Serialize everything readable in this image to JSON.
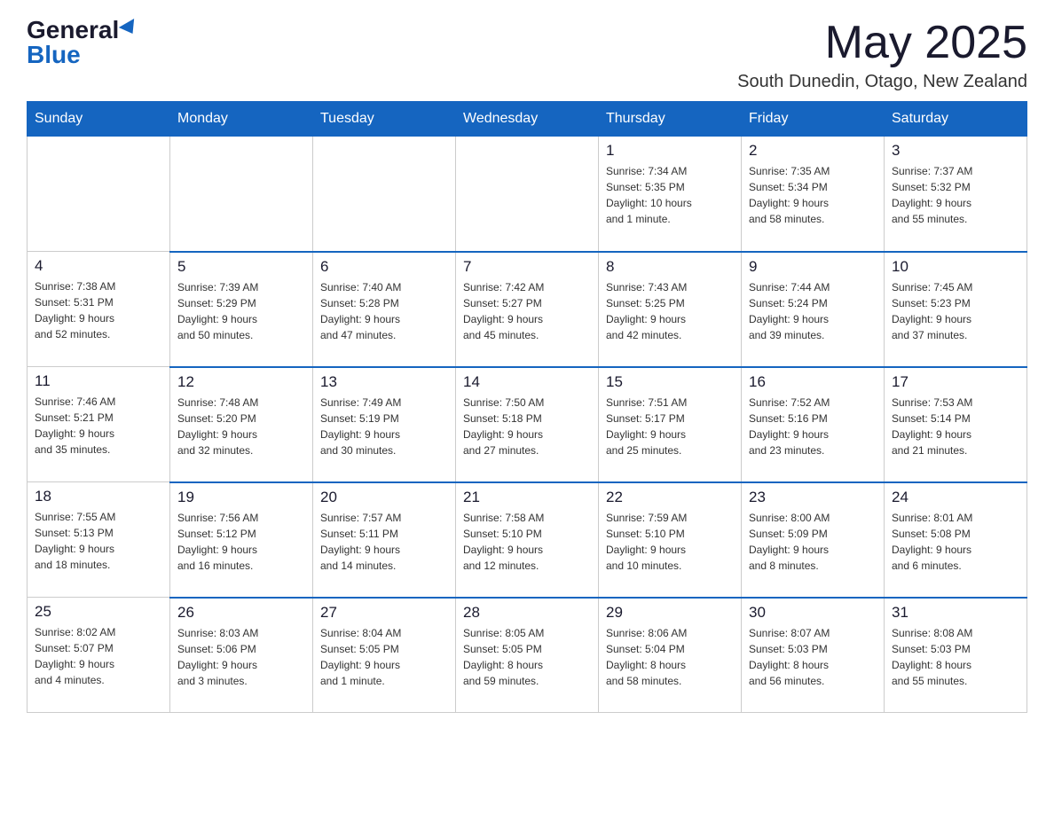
{
  "header": {
    "logo_general": "General",
    "logo_blue": "Blue",
    "month_title": "May 2025",
    "location": "South Dunedin, Otago, New Zealand"
  },
  "weekdays": [
    "Sunday",
    "Monday",
    "Tuesday",
    "Wednesday",
    "Thursday",
    "Friday",
    "Saturday"
  ],
  "weeks": [
    [
      {
        "day": "",
        "info": ""
      },
      {
        "day": "",
        "info": ""
      },
      {
        "day": "",
        "info": ""
      },
      {
        "day": "",
        "info": ""
      },
      {
        "day": "1",
        "info": "Sunrise: 7:34 AM\nSunset: 5:35 PM\nDaylight: 10 hours\nand 1 minute."
      },
      {
        "day": "2",
        "info": "Sunrise: 7:35 AM\nSunset: 5:34 PM\nDaylight: 9 hours\nand 58 minutes."
      },
      {
        "day": "3",
        "info": "Sunrise: 7:37 AM\nSunset: 5:32 PM\nDaylight: 9 hours\nand 55 minutes."
      }
    ],
    [
      {
        "day": "4",
        "info": "Sunrise: 7:38 AM\nSunset: 5:31 PM\nDaylight: 9 hours\nand 52 minutes."
      },
      {
        "day": "5",
        "info": "Sunrise: 7:39 AM\nSunset: 5:29 PM\nDaylight: 9 hours\nand 50 minutes."
      },
      {
        "day": "6",
        "info": "Sunrise: 7:40 AM\nSunset: 5:28 PM\nDaylight: 9 hours\nand 47 minutes."
      },
      {
        "day": "7",
        "info": "Sunrise: 7:42 AM\nSunset: 5:27 PM\nDaylight: 9 hours\nand 45 minutes."
      },
      {
        "day": "8",
        "info": "Sunrise: 7:43 AM\nSunset: 5:25 PM\nDaylight: 9 hours\nand 42 minutes."
      },
      {
        "day": "9",
        "info": "Sunrise: 7:44 AM\nSunset: 5:24 PM\nDaylight: 9 hours\nand 39 minutes."
      },
      {
        "day": "10",
        "info": "Sunrise: 7:45 AM\nSunset: 5:23 PM\nDaylight: 9 hours\nand 37 minutes."
      }
    ],
    [
      {
        "day": "11",
        "info": "Sunrise: 7:46 AM\nSunset: 5:21 PM\nDaylight: 9 hours\nand 35 minutes."
      },
      {
        "day": "12",
        "info": "Sunrise: 7:48 AM\nSunset: 5:20 PM\nDaylight: 9 hours\nand 32 minutes."
      },
      {
        "day": "13",
        "info": "Sunrise: 7:49 AM\nSunset: 5:19 PM\nDaylight: 9 hours\nand 30 minutes."
      },
      {
        "day": "14",
        "info": "Sunrise: 7:50 AM\nSunset: 5:18 PM\nDaylight: 9 hours\nand 27 minutes."
      },
      {
        "day": "15",
        "info": "Sunrise: 7:51 AM\nSunset: 5:17 PM\nDaylight: 9 hours\nand 25 minutes."
      },
      {
        "day": "16",
        "info": "Sunrise: 7:52 AM\nSunset: 5:16 PM\nDaylight: 9 hours\nand 23 minutes."
      },
      {
        "day": "17",
        "info": "Sunrise: 7:53 AM\nSunset: 5:14 PM\nDaylight: 9 hours\nand 21 minutes."
      }
    ],
    [
      {
        "day": "18",
        "info": "Sunrise: 7:55 AM\nSunset: 5:13 PM\nDaylight: 9 hours\nand 18 minutes."
      },
      {
        "day": "19",
        "info": "Sunrise: 7:56 AM\nSunset: 5:12 PM\nDaylight: 9 hours\nand 16 minutes."
      },
      {
        "day": "20",
        "info": "Sunrise: 7:57 AM\nSunset: 5:11 PM\nDaylight: 9 hours\nand 14 minutes."
      },
      {
        "day": "21",
        "info": "Sunrise: 7:58 AM\nSunset: 5:10 PM\nDaylight: 9 hours\nand 12 minutes."
      },
      {
        "day": "22",
        "info": "Sunrise: 7:59 AM\nSunset: 5:10 PM\nDaylight: 9 hours\nand 10 minutes."
      },
      {
        "day": "23",
        "info": "Sunrise: 8:00 AM\nSunset: 5:09 PM\nDaylight: 9 hours\nand 8 minutes."
      },
      {
        "day": "24",
        "info": "Sunrise: 8:01 AM\nSunset: 5:08 PM\nDaylight: 9 hours\nand 6 minutes."
      }
    ],
    [
      {
        "day": "25",
        "info": "Sunrise: 8:02 AM\nSunset: 5:07 PM\nDaylight: 9 hours\nand 4 minutes."
      },
      {
        "day": "26",
        "info": "Sunrise: 8:03 AM\nSunset: 5:06 PM\nDaylight: 9 hours\nand 3 minutes."
      },
      {
        "day": "27",
        "info": "Sunrise: 8:04 AM\nSunset: 5:05 PM\nDaylight: 9 hours\nand 1 minute."
      },
      {
        "day": "28",
        "info": "Sunrise: 8:05 AM\nSunset: 5:05 PM\nDaylight: 8 hours\nand 59 minutes."
      },
      {
        "day": "29",
        "info": "Sunrise: 8:06 AM\nSunset: 5:04 PM\nDaylight: 8 hours\nand 58 minutes."
      },
      {
        "day": "30",
        "info": "Sunrise: 8:07 AM\nSunset: 5:03 PM\nDaylight: 8 hours\nand 56 minutes."
      },
      {
        "day": "31",
        "info": "Sunrise: 8:08 AM\nSunset: 5:03 PM\nDaylight: 8 hours\nand 55 minutes."
      }
    ]
  ]
}
